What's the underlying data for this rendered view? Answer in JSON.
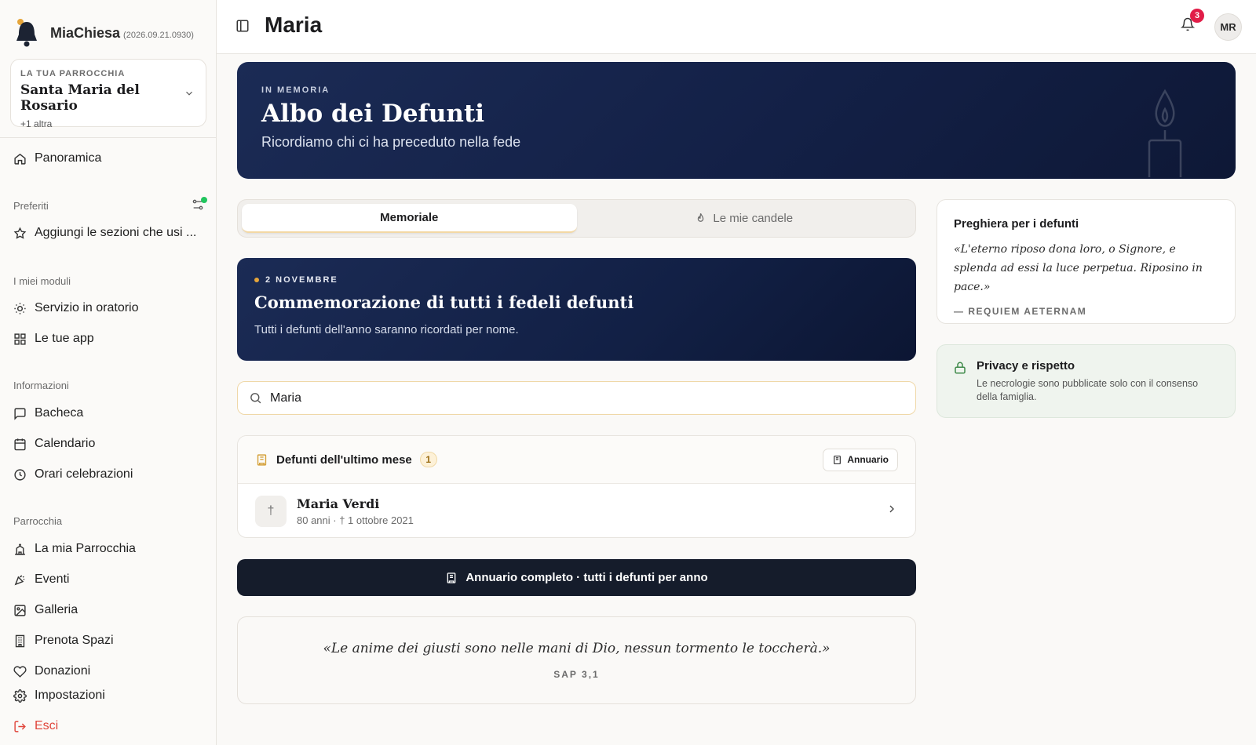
{
  "app": {
    "name": "MiaChiesa",
    "version": "(2026.09.21.0930)"
  },
  "parish": {
    "kicker": "LA TUA PARROCCHIA",
    "name": "Santa Maria del Rosario",
    "more": "+1 altra"
  },
  "sidebar": {
    "overview": "Panoramica",
    "favorites_label": "Preferiti",
    "favorites_add": "Aggiungi le sezioni che usi ...",
    "modules_label": "I miei moduli",
    "modules": [
      "Servizio in oratorio",
      "Le tue app"
    ],
    "info_label": "Informazioni",
    "info": [
      "Bacheca",
      "Calendario",
      "Orari celebrazioni"
    ],
    "parish_label": "Parrocchia",
    "parish_items": [
      "La mia Parrocchia",
      "Eventi",
      "Galleria",
      "Prenota Spazi",
      "Donazioni"
    ],
    "settings": "Impostazioni",
    "logout": "Esci"
  },
  "topbar": {
    "title": "Maria",
    "notifications_count": "3",
    "avatar_initials": "MR"
  },
  "hero": {
    "kicker": "IN MEMORIA",
    "title": "Albo dei Defunti",
    "subtitle": "Ricordiamo chi ci ha preceduto nella fede"
  },
  "tabs": [
    {
      "label": "Memoriale",
      "active": true
    },
    {
      "label": "Le mie candele",
      "active": false
    }
  ],
  "commemoration": {
    "kicker": "2 NOVEMBRE",
    "title": "Commemorazione di tutti i fedeli defunti",
    "subtitle": "Tutti i defunti dell'anno saranno ricordati per nome."
  },
  "search": {
    "value": "Maria"
  },
  "deceased_list": {
    "title": "Defunti dell'ultimo mese",
    "count": "1",
    "yearbook_button": "Annuario",
    "items": [
      {
        "name": "Maria Verdi",
        "meta": "80 anni · † 1 ottobre 2021"
      }
    ]
  },
  "cta": {
    "label": "Annuario completo · tutti i defunti per anno"
  },
  "quote": {
    "text": "«Le anime dei giusti sono nelle mani di Dio, nessun tormento le toccherà.»",
    "ref": "SAP 3,1"
  },
  "prayer": {
    "title": "Preghiera per i defunti",
    "text": "«L'eterno riposo dona loro, o Signore, e splenda ad essi la luce perpetua. Riposino in pace.»",
    "ref": "— REQUIEM AETERNAM"
  },
  "privacy": {
    "title": "Privacy e rispetto",
    "text": "Le necrologie sono pubblicate solo con il consenso della famiglia."
  },
  "colors": {
    "navy": "#132046",
    "accent_gold": "#e6a53a",
    "logout_red": "#e0443a",
    "cta_dark": "#151c2b"
  }
}
